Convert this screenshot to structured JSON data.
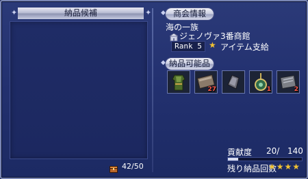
{
  "left": {
    "title": "納品候補",
    "capacity": "42/50"
  },
  "right": {
    "company_header": "商会情報",
    "company_name": "海の一族",
    "hall_name": "ジェノヴァ3番商館",
    "rank_label": "Rank 5",
    "support_label": "アイテム支給",
    "deliverable_header": "納品可能品",
    "items": [
      {
        "icon": "green-armor-icon",
        "qty": ""
      },
      {
        "icon": "scroll-icon",
        "qty": "27"
      },
      {
        "icon": "gauntlet-icon",
        "qty": ""
      },
      {
        "icon": "amulet-icon",
        "qty": "1"
      },
      {
        "icon": "document-icon",
        "qty": "2"
      }
    ],
    "contribution_label": "貢献度",
    "contribution_value": "20/",
    "contribution_max": "140",
    "contribution_fraction": 0.143,
    "remaining_label": "残り納品回数",
    "remaining_stars": "★★★★"
  },
  "colors": {
    "star": "#f1c232",
    "qty": "#ff5a4a"
  }
}
